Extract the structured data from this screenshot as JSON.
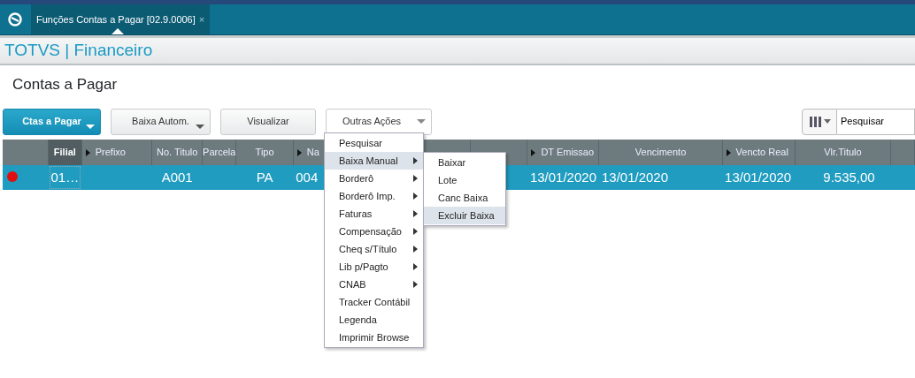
{
  "app_tab": {
    "label": "Funções Contas a Pagar [02.9.0006]",
    "close": "×"
  },
  "header": {
    "title": "TOTVS | Financeiro"
  },
  "page_title": "Contas a Pagar",
  "toolbar": [
    {
      "label": "Ctas a Pagar",
      "kind": "primary",
      "dropdown": true
    },
    {
      "label": "Baixa Autom.",
      "kind": "default",
      "dropdown": true
    },
    {
      "label": "Visualizar",
      "kind": "default",
      "dropdown": false
    },
    {
      "label": "Outras Ações",
      "kind": "menu",
      "dropdown": true
    }
  ],
  "search": {
    "placeholder": "Pesquisar"
  },
  "table": {
    "columns": [
      {
        "sort": false,
        "selected": false
      },
      {
        "label": "Filial",
        "sort": false,
        "selected": true
      },
      {
        "label": "Prefixo",
        "sort": true,
        "selected": false
      },
      {
        "label": "No. Titulo",
        "sort": false,
        "selected": false
      },
      {
        "label": "Parcela",
        "sort": false,
        "selected": false
      },
      {
        "label": "Tipo",
        "sort": false,
        "selected": false
      },
      {
        "label": "Na",
        "sort": true,
        "selected": false
      },
      {
        "sort": false,
        "selected": false
      },
      {
        "sort": false,
        "selected": false
      },
      {
        "label": "DT Emissao",
        "sort": true,
        "selected": false
      },
      {
        "label": "Vencimento",
        "sort": false,
        "selected": false
      },
      {
        "label": "Vencto Real",
        "sort": true,
        "selected": false
      },
      {
        "label": "Vlr.Titulo",
        "sort": false,
        "selected": false
      },
      {
        "sort": false,
        "selected": false
      }
    ],
    "rows": [
      {
        "selected": true,
        "color": "#e01010",
        "cells": [
          "",
          "01…",
          "",
          "A001",
          "",
          "PA",
          "004",
          "",
          "",
          "13/01/2020",
          "13/01/2020",
          "13/01/2020",
          "9.535,00"
        ]
      }
    ]
  },
  "menu": [
    {
      "label": "Pesquisar",
      "submenu": false,
      "highlighted": false
    },
    {
      "label": "Baixa Manual",
      "submenu": true,
      "highlighted": true
    },
    {
      "label": "Borderô",
      "submenu": true,
      "highlighted": false
    },
    {
      "label": "Borderô Imp.",
      "submenu": true,
      "highlighted": false
    },
    {
      "label": "Faturas",
      "submenu": true,
      "highlighted": false
    },
    {
      "label": "Compensação",
      "submenu": true,
      "highlighted": false
    },
    {
      "label": "Cheq s/Título",
      "submenu": true,
      "highlighted": false
    },
    {
      "label": "Lib p/Pagto",
      "submenu": true,
      "highlighted": false
    },
    {
      "label": "CNAB",
      "submenu": true,
      "highlighted": false
    },
    {
      "label": "Tracker Contábil",
      "submenu": false,
      "highlighted": false
    },
    {
      "label": "Legenda",
      "submenu": false,
      "highlighted": false
    },
    {
      "label": "Imprimir Browse",
      "submenu": false,
      "highlighted": false
    }
  ],
  "submenu": [
    {
      "label": "Baixar",
      "highlighted": false
    },
    {
      "label": "Lote",
      "highlighted": false
    },
    {
      "label": "Canc Baixa",
      "highlighted": false
    },
    {
      "label": "Excluir Baixa",
      "highlighted": true
    }
  ]
}
